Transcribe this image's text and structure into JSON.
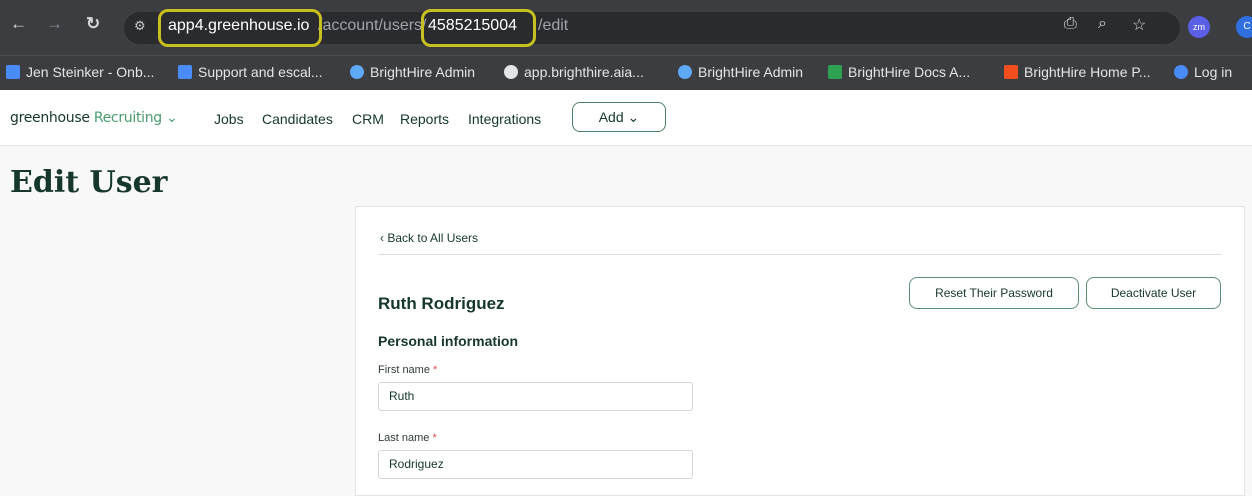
{
  "browser": {
    "url_host": "app4.greenhouse.io",
    "url_path": "/account/users/",
    "url_id": "4585215004",
    "url_tail": "/edit",
    "profile_initials": "zm",
    "profile2_initials": "C"
  },
  "bookmarks": [
    {
      "label": "Jen Steinker - Onb...",
      "icon": "docs-icon",
      "color": "#4a8cf7"
    },
    {
      "label": "Support and escal...",
      "icon": "docs-icon",
      "color": "#4a8cf7"
    },
    {
      "label": "BrightHire Admin",
      "icon": "gear-icon",
      "color": "#5fa8f5"
    },
    {
      "label": "app.brighthire.aia...",
      "icon": "globe-icon",
      "color": "#e3e5e8"
    },
    {
      "label": "BrightHire Admin",
      "icon": "gear-icon",
      "color": "#5fa8f5"
    },
    {
      "label": "BrightHire Docs A...",
      "icon": "sheets-icon",
      "color": "#2fa152"
    },
    {
      "label": "BrightHire Home P...",
      "icon": "figma-icon",
      "color": "#f24e1e"
    },
    {
      "label": "Log in",
      "icon": "drop-icon",
      "color": "#4a8cf7"
    }
  ],
  "nav": {
    "logo_main": "greenhouse",
    "logo_product": "Recruiting",
    "links": [
      "Jobs",
      "Candidates",
      "CRM",
      "Reports",
      "Integrations"
    ],
    "add_label": "Add"
  },
  "page": {
    "title": "Edit User",
    "back_link": "Back to All Users",
    "user_name": "Ruth Rodriguez",
    "reset_password": "Reset Their Password",
    "deactivate": "Deactivate User",
    "section_title": "Personal information",
    "first_name_label": "First name",
    "first_name_value": "Ruth",
    "last_name_label": "Last name",
    "last_name_value": "Rodriguez",
    "required_mark": "*"
  }
}
